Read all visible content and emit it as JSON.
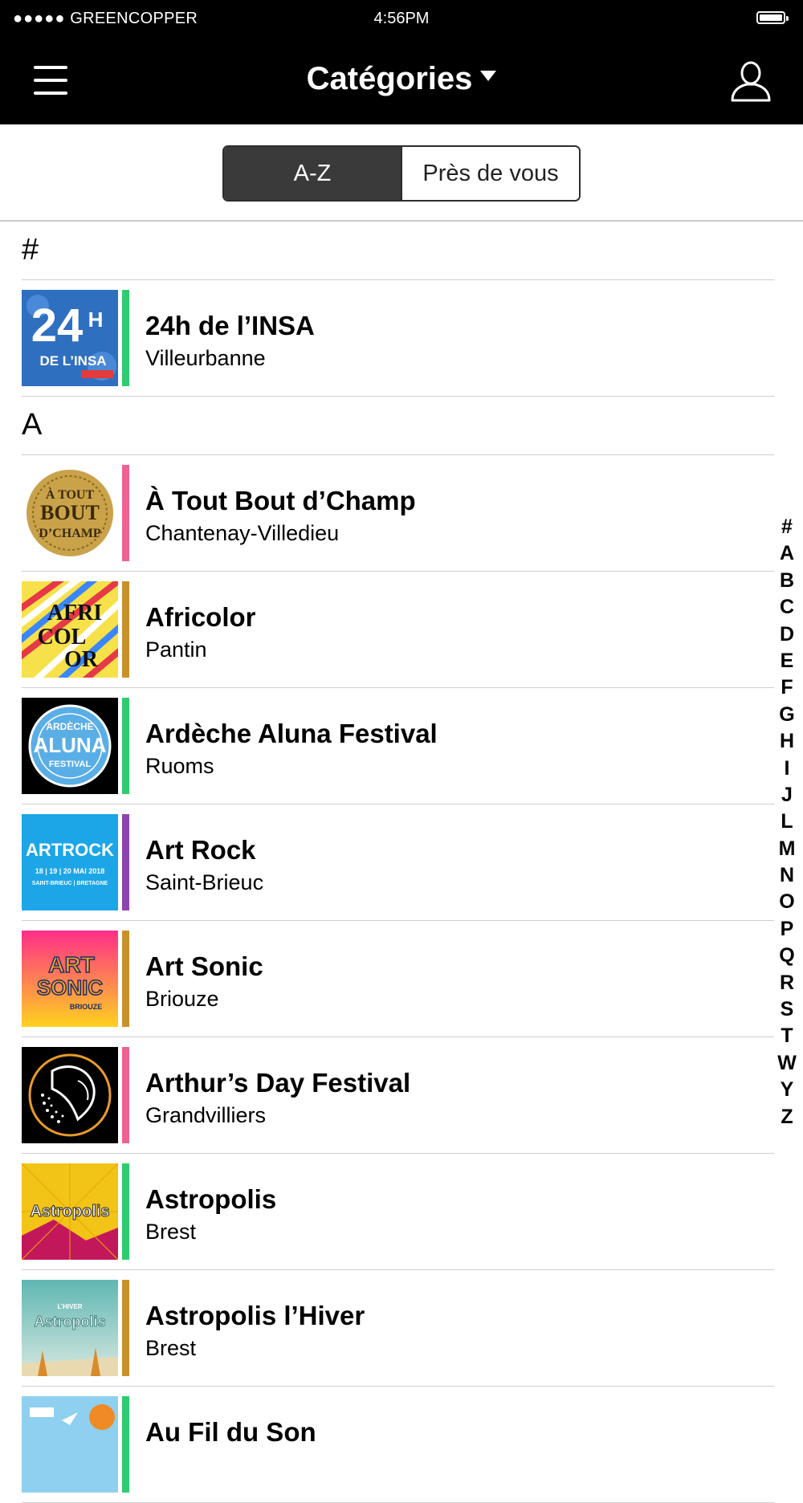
{
  "status_bar": {
    "signal_dots": "●●●●●",
    "carrier": "GREENCOPPER",
    "time": "4:56PM"
  },
  "nav": {
    "title": "Catégories"
  },
  "tabs": [
    {
      "label": "A-Z",
      "active": true
    },
    {
      "label": "Près de vous",
      "active": false
    }
  ],
  "sections": [
    {
      "header": "#",
      "items": [
        {
          "title": "24h de l’INSA",
          "subtitle": "Villeurbanne",
          "accent": "#2ecc71",
          "icon": "24h-insa-logo"
        }
      ]
    },
    {
      "header": "A",
      "items": [
        {
          "title": "À Tout Bout d’Champ",
          "subtitle": "Chantenay-Villedieu",
          "accent": "#f06292",
          "icon": "a-tout-bout-logo"
        },
        {
          "title": "Africolor",
          "subtitle": "Pantin",
          "accent": "#c8922a",
          "icon": "africolor-logo"
        },
        {
          "title": "Ardèche Aluna Festival",
          "subtitle": "Ruoms",
          "accent": "#2ecc71",
          "icon": "aluna-logo"
        },
        {
          "title": "Art Rock",
          "subtitle": "Saint-Brieuc",
          "accent": "#8e44ad",
          "icon": "art-rock-logo"
        },
        {
          "title": "Art Sonic",
          "subtitle": "Briouze",
          "accent": "#c8922a",
          "icon": "art-sonic-logo"
        },
        {
          "title": "Arthur’s Day Festival",
          "subtitle": "Grandvilliers",
          "accent": "#f06292",
          "icon": "arthurs-day-logo"
        },
        {
          "title": "Astropolis",
          "subtitle": "Brest",
          "accent": "#2ecc71",
          "icon": "astropolis-logo"
        },
        {
          "title": "Astropolis l’Hiver",
          "subtitle": "Brest",
          "accent": "#c8922a",
          "icon": "astropolis-hiver-logo"
        },
        {
          "title": "Au Fil du Son",
          "subtitle": "",
          "accent": "#2ecc71",
          "icon": "au-fil-du-son-logo"
        }
      ]
    }
  ],
  "logo_text": {
    "insa": [
      "24",
      "H",
      "DE L’INSA"
    ],
    "atout": [
      "À TOUT",
      "BOUT",
      "D’CHAMP"
    ],
    "africolor": [
      "AFRI",
      "COL",
      "OR"
    ],
    "aluna": [
      "ARDÈCHE",
      "ALUNA",
      "FESTIVAL"
    ],
    "artrock": [
      "ARTROCK",
      "18 | 19 | 20 MAI 2018",
      "SAINT-BRIEUC | BRETAGNE"
    ],
    "artsonic": [
      "ART",
      "SONIC",
      "BRIOUZE"
    ],
    "astropolis": [
      "Astropolis"
    ],
    "astropolis_hiver": [
      "L’HIVER",
      "Astropolis"
    ]
  },
  "alphabet_index": [
    "#",
    "A",
    "B",
    "C",
    "D",
    "E",
    "F",
    "G",
    "H",
    "I",
    "J",
    "L",
    "M",
    "N",
    "O",
    "P",
    "Q",
    "R",
    "S",
    "T",
    "W",
    "Y",
    "Z"
  ]
}
